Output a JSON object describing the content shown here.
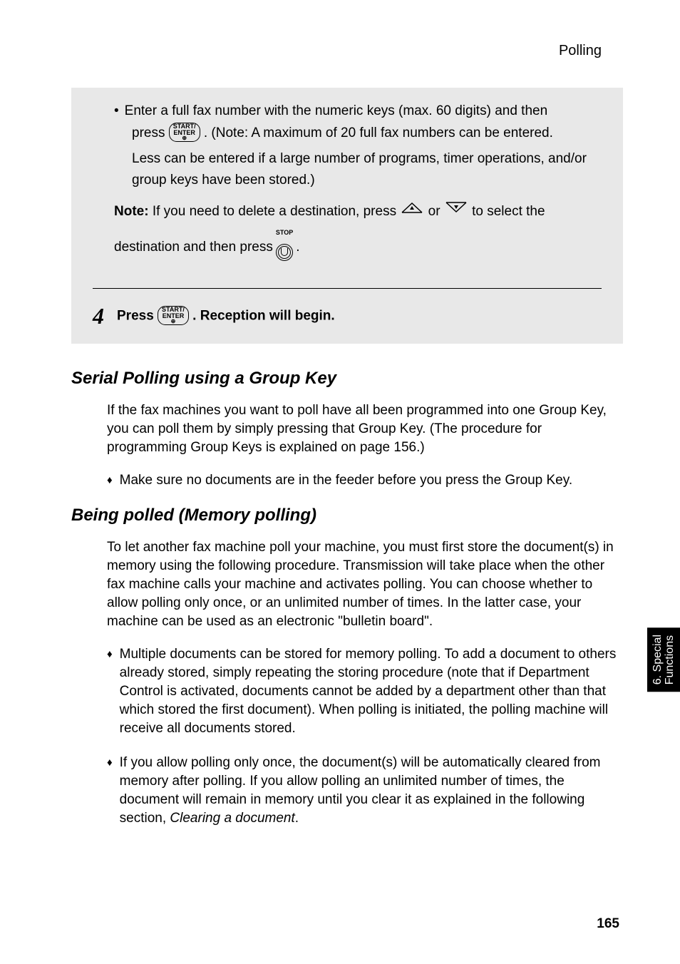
{
  "header": "Polling",
  "grayBox": {
    "bullet1Line1": "Enter a full fax number with the numeric keys (max. 60 digits) and then",
    "bullet1Line2a": "press ",
    "bullet1Line2b": ". (Note: A maximum of 20 full fax numbers can be entered.",
    "bullet1Line3": "Less can be entered if a large number of programs, timer operations, and/or group keys have been stored.)",
    "noteLabel": "Note:",
    "noteText1": " If you need to delete a destination, press ",
    "noteText2": " or ",
    "noteText3": "  to select the",
    "noteLine2a": "destination and then press ",
    "noteLine2b": " .",
    "step4Num": "4",
    "step4a": "Press ",
    "step4b": " . Reception will begin.",
    "startEnter": "START/\nENTER",
    "stopLabel": "STOP"
  },
  "section1": {
    "heading": "Serial Polling using a Group Key",
    "para1": "If the fax machines you want to poll have all been programmed into one Group Key, you can poll them by simply pressing that Group Key. (The procedure for programming Group Keys is explained on page 156.)",
    "diamond1": "Make sure no documents are in the feeder before you press the Group Key."
  },
  "section2": {
    "heading": "Being polled (Memory polling)",
    "para1": "To let another fax machine poll your machine, you must first store the document(s) in memory using the following procedure. Transmission will take place when the other fax machine calls your machine and activates polling. You can choose whether to allow polling only once, or an unlimited number of times. In the latter case, your machine can be used as an electronic \"bulletin board\".",
    "diamond1": "Multiple documents can be stored for memory polling. To add a document to others already stored, simply repeating the storing procedure (note that if Department Control is activated, documents cannot be added by a department other than that which stored the first document). When polling is initiated, the polling machine will receive all documents stored.",
    "diamond2a": "If you allow polling only once, the document(s) will be automatically cleared from memory after polling. If you allow polling an unlimited number of times, the document will remain in memory until you clear it as explained in the following section, ",
    "diamond2Italic": "Clearing a document",
    "diamond2b": "."
  },
  "sideTab": {
    "line1": "6. Special",
    "line2": "Functions"
  },
  "pageNumber": "165"
}
